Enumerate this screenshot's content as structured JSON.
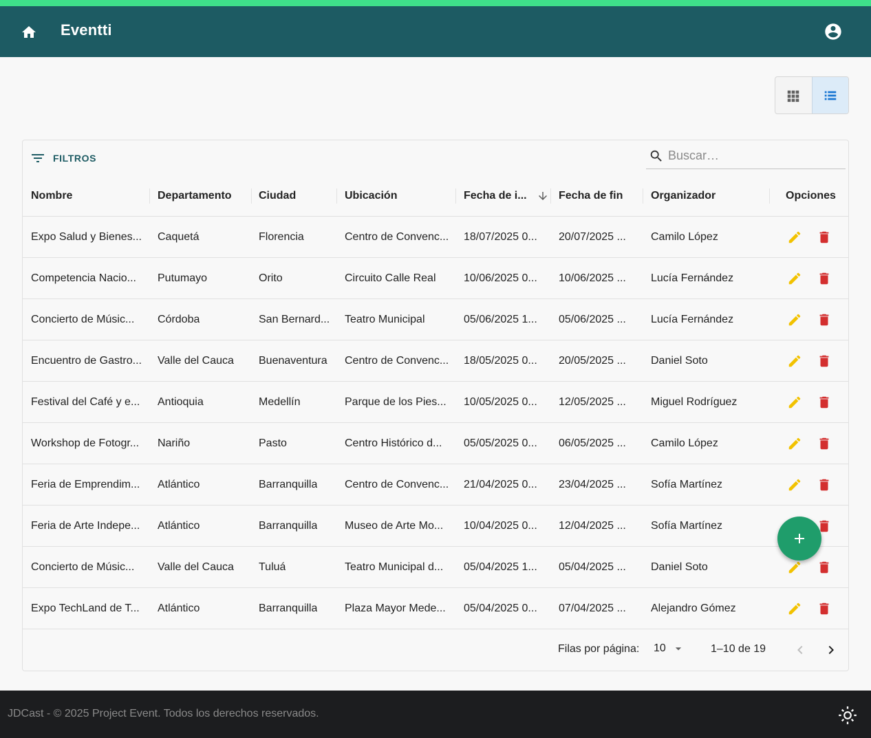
{
  "app": {
    "title": "Eventti"
  },
  "view_toggle": {
    "options": [
      "grid-view",
      "list-view"
    ],
    "active": "list-view"
  },
  "toolbar": {
    "filters_label": "FILTROS",
    "search_placeholder": "Buscar…"
  },
  "table": {
    "columns": [
      "Nombre",
      "Departamento",
      "Ciudad",
      "Ubicación",
      "Fecha de i...",
      "Fecha de fin",
      "Organizador",
      "Opciones"
    ],
    "sort": {
      "column": "Fecha de i...",
      "direction": "descending"
    },
    "rows": [
      [
        "Expo Salud y Bienes...",
        "Caquetá",
        "Florencia",
        "Centro de Convenc...",
        "18/07/2025 0...",
        "20/07/2025 ...",
        "Camilo López"
      ],
      [
        "Competencia Nacio...",
        "Putumayo",
        "Orito",
        "Circuito Calle Real",
        "10/06/2025 0...",
        "10/06/2025 ...",
        "Lucía Fernández"
      ],
      [
        "Concierto de Músic...",
        "Córdoba",
        "San Bernard...",
        "Teatro Municipal",
        "05/06/2025 1...",
        "05/06/2025 ...",
        "Lucía Fernández"
      ],
      [
        "Encuentro de Gastro...",
        "Valle del Cauca",
        "Buenaventura",
        "Centro de Convenc...",
        "18/05/2025 0...",
        "20/05/2025 ...",
        "Daniel Soto"
      ],
      [
        "Festival del Café y e...",
        "Antioquia",
        "Medellín",
        "Parque de los Pies...",
        "10/05/2025 0...",
        "12/05/2025 ...",
        "Miguel Rodríguez"
      ],
      [
        "Workshop de Fotogr...",
        "Nariño",
        "Pasto",
        "Centro Histórico d...",
        "05/05/2025 0...",
        "06/05/2025 ...",
        "Camilo López"
      ],
      [
        "Feria de Emprendim...",
        "Atlántico",
        "Barranquilla",
        "Centro de Convenc...",
        "21/04/2025 0...",
        "23/04/2025 ...",
        "Sofía Martínez"
      ],
      [
        "Feria de Arte Indepe...",
        "Atlántico",
        "Barranquilla",
        "Museo de Arte Mo...",
        "10/04/2025 0...",
        "12/04/2025 ...",
        "Sofía Martínez"
      ],
      [
        "Concierto de Músic...",
        "Valle del Cauca",
        "Tuluá",
        "Teatro Municipal d...",
        "05/04/2025 1...",
        "05/04/2025 ...",
        "Daniel Soto"
      ],
      [
        "Expo TechLand de T...",
        "Atlántico",
        "Barranquilla",
        "Plaza Mayor Mede...",
        "05/04/2025 0...",
        "07/04/2025 ...",
        "Alejandro Gómez"
      ]
    ],
    "row_actions": [
      "edit-icon",
      "delete-icon"
    ]
  },
  "pagination": {
    "rows_per_page_label": "Filas por página:",
    "rows_per_page": "10",
    "range": "1–10 de 19"
  },
  "footer": {
    "copyright": "JDCast - © 2025 Project Event. Todos los derechos reservados."
  },
  "colors": {
    "accent_bar": "#3ee08a",
    "appbar": "#1d5b63",
    "edit_icon": "#f2c200",
    "delete_icon": "#d32f2f",
    "fab": "#1f9d6b",
    "footer": "#1c1d1f"
  }
}
